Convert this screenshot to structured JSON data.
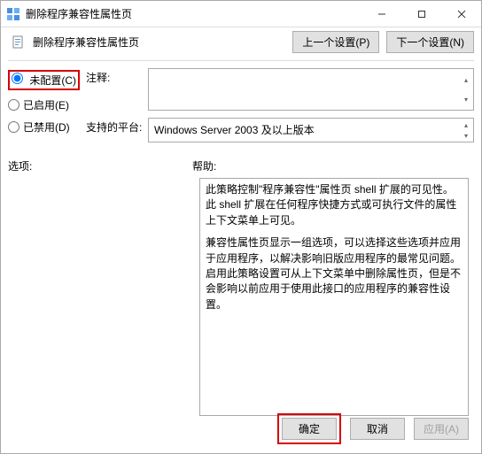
{
  "window": {
    "title": "删除程序兼容性属性页"
  },
  "header": {
    "title": "删除程序兼容性属性页",
    "prev_btn": "上一个设置(P)",
    "next_btn": "下一个设置(N)"
  },
  "radios": {
    "not_configured": "未配置(C)",
    "enabled": "已启用(E)",
    "disabled": "已禁用(D)"
  },
  "fields": {
    "comment_label": "注释:",
    "comment_value": "",
    "platform_label": "支持的平台:",
    "platform_value": "Windows Server 2003 及以上版本"
  },
  "sections": {
    "options_label": "选项:",
    "help_label": "帮助:"
  },
  "help_text": {
    "p1": "此策略控制\"程序兼容性\"属性页 shell 扩展的可见性。此 shell 扩展在任何程序快捷方式或可执行文件的属性上下文菜单上可见。",
    "p2": "兼容性属性页显示一组选项，可以选择这些选项并应用于应用程序，以解决影响旧版应用程序的最常见问题。启用此策略设置可从上下文菜单中删除属性页，但是不会影响以前应用于使用此接口的应用程序的兼容性设置。"
  },
  "buttons": {
    "ok": "确定",
    "cancel": "取消",
    "apply": "应用(A)"
  }
}
